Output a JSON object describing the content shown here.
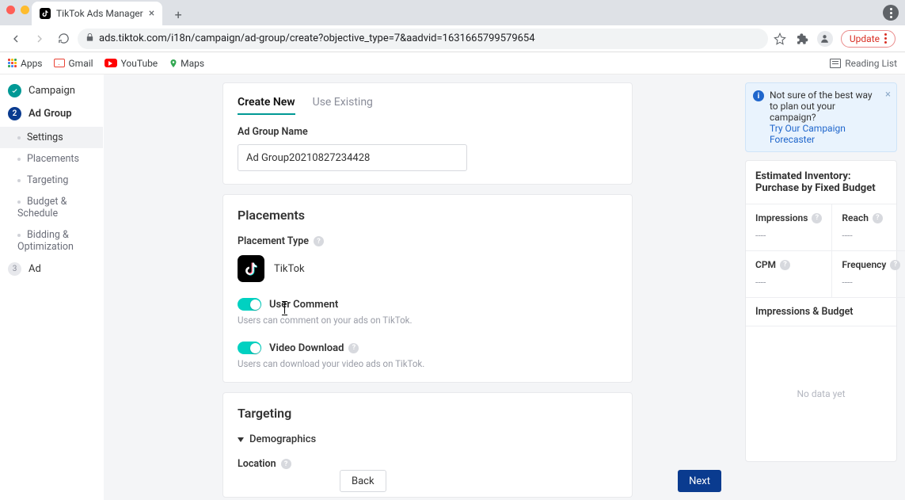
{
  "browser": {
    "tab_title": "TikTok Ads Manager",
    "url": "ads.tiktok.com/i18n/campaign/ad-group/create?objective_type=7&aadvid=1631665799579654",
    "update_label": "Update",
    "bookmarks": {
      "apps": "Apps",
      "gmail": "Gmail",
      "youtube": "YouTube",
      "maps": "Maps",
      "reading": "Reading List"
    }
  },
  "sidebar": {
    "steps": [
      {
        "label": "Campaign"
      },
      {
        "label": "Ad Group",
        "num": "2"
      },
      {
        "label": "Ad",
        "num": "3"
      }
    ],
    "substeps": [
      {
        "label": "Settings",
        "active": true
      },
      {
        "label": "Placements"
      },
      {
        "label": "Targeting"
      },
      {
        "label": "Budget & Schedule"
      },
      {
        "label": "Bidding & Optimization"
      }
    ]
  },
  "tabs": {
    "create": "Create New",
    "existing": "Use Existing"
  },
  "adgroup": {
    "name_label": "Ad Group Name",
    "name_value": "Ad Group20210827234428"
  },
  "placements": {
    "title": "Placements",
    "type_label": "Placement Type",
    "tiktok": "TikTok",
    "user_comment": {
      "label": "User Comment",
      "desc": "Users can comment on your ads on TikTok."
    },
    "video_download": {
      "label": "Video Download",
      "desc": "Users can download your video ads on TikTok."
    }
  },
  "targeting": {
    "title": "Targeting",
    "demographics": "Demographics",
    "location": "Location"
  },
  "notice": {
    "text": "Not sure of the best way to plan out your campaign?",
    "link": "Try Our Campaign Forecaster"
  },
  "inventory": {
    "title": "Estimated Inventory: Purchase by Fixed Budget",
    "metrics": [
      {
        "name": "Impressions",
        "value": "----"
      },
      {
        "name": "Reach",
        "value": "----"
      },
      {
        "name": "CPM",
        "value": "----"
      },
      {
        "name": "Frequency",
        "value": "----"
      }
    ],
    "section": "Impressions & Budget",
    "nodata": "No data yet"
  },
  "footer": {
    "back": "Back",
    "next": "Next"
  }
}
